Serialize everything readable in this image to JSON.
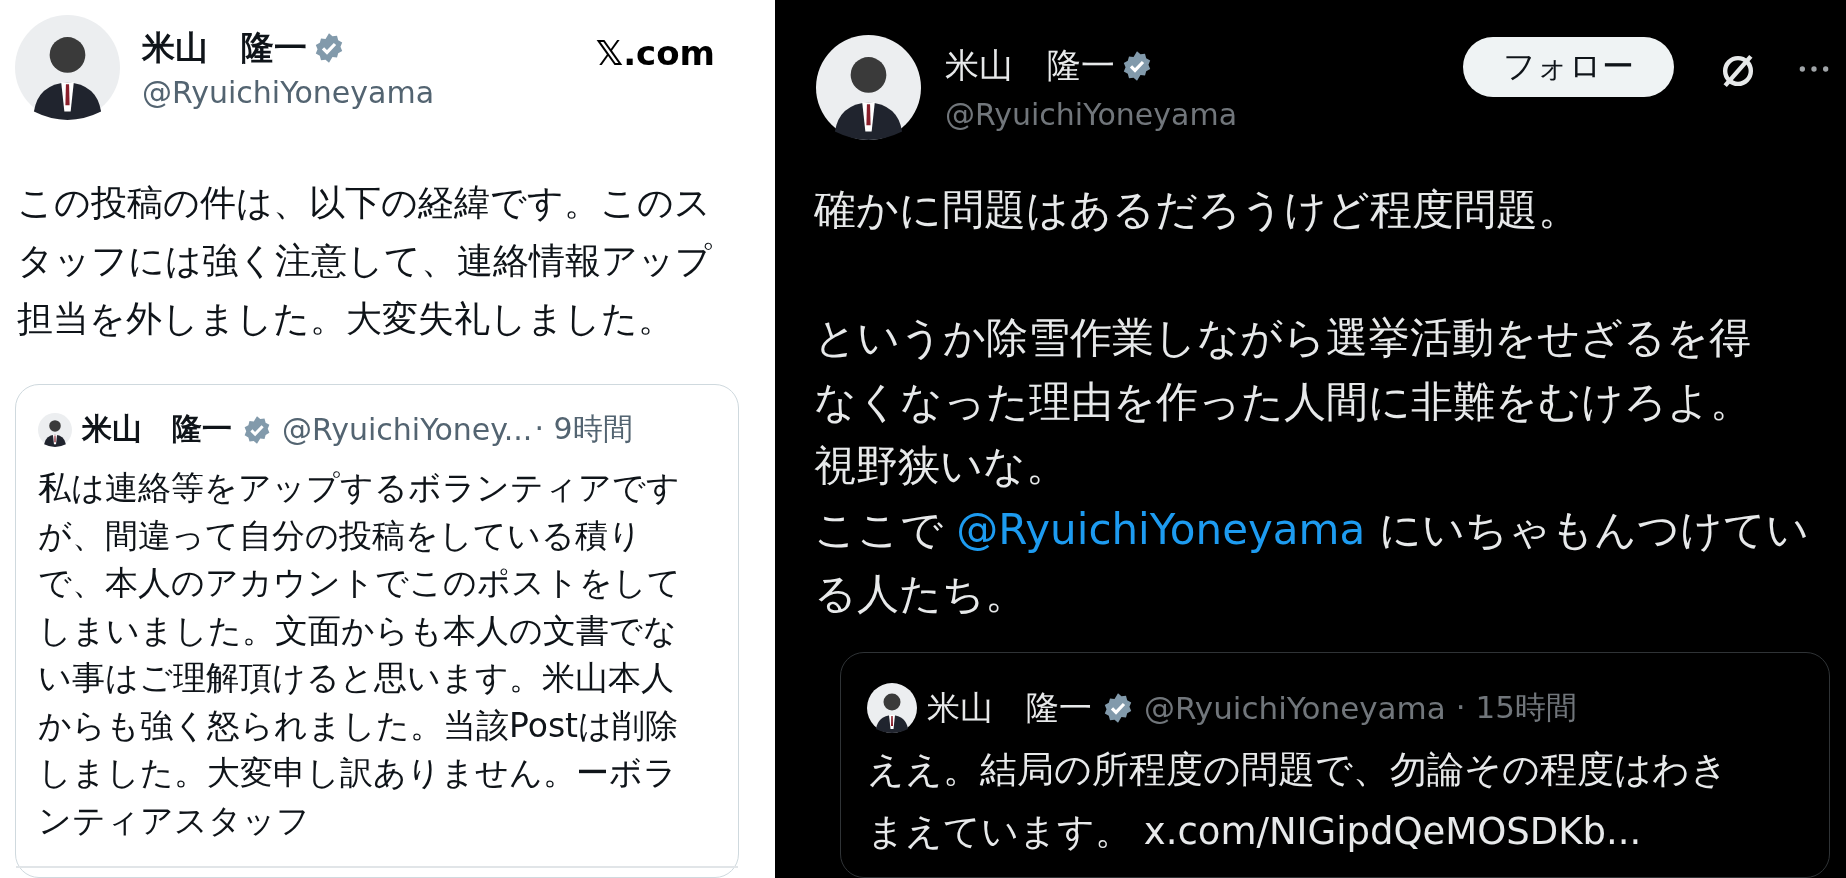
{
  "left_post": {
    "author": {
      "name": "米山　隆一",
      "verified": true,
      "handle": "@RyuichiYoneyama"
    },
    "site_logo": "𝕏.com",
    "text_lines": [
      "この投稿の件は、以下の経緯です。このス",
      "タッフには強く注意して、連絡情報アップ",
      "担当を外しました。大変失礼しました。"
    ],
    "quote": {
      "author": {
        "name": "米山　隆一",
        "verified": true,
        "handle": "@RyuichiYoney...",
        "time": "· 9時間"
      },
      "text_lines": [
        "私は連絡等をアップするボランティアです",
        "が、間違って自分の投稿をしている積り",
        "で、本人のアカウントでこのポストをして",
        "しまいました。文面からも本人の文書でな",
        "い事はご理解頂けると思います。米山本人",
        "からも強く怒られました。当該Postは削除",
        "しました。大変申し訳ありません。ーボラ",
        "ンティアスタッフ"
      ]
    }
  },
  "right_post": {
    "author": {
      "name": "米山　隆一",
      "verified": true,
      "handle": "@RyuichiYoneyama"
    },
    "follow_button": "フォロー",
    "paragraphs": [
      {
        "lines": [
          [
            {
              "kind": "text",
              "text": "確かに問題はあるだろうけど程度問題。"
            }
          ]
        ]
      },
      {
        "lines": [
          [
            {
              "kind": "text",
              "text": "というか除雪作業しながら選挙活動をせざるを得"
            }
          ],
          [
            {
              "kind": "text",
              "text": "なくなった理由を作った人間に非難をむけろよ。"
            }
          ],
          [
            {
              "kind": "text",
              "text": "視野狭いな。"
            }
          ],
          [
            {
              "kind": "text",
              "text": "ここで "
            },
            {
              "kind": "mention",
              "text": "@RyuichiYoneyama"
            },
            {
              "kind": "text",
              "text": " にいちゃもんつけてい"
            }
          ],
          [
            {
              "kind": "text",
              "text": "る人たち。"
            }
          ]
        ]
      }
    ],
    "quote": {
      "author": {
        "name": "米山　隆一",
        "verified": true,
        "handle": "@RyuichiYoneyama",
        "time": "· 15時間"
      },
      "text_lines": [
        "ええ。結局の所程度の問題で、勿論その程度はわき",
        "まえています。 x.com/NIGipdQeMOSDKb..."
      ]
    }
  }
}
